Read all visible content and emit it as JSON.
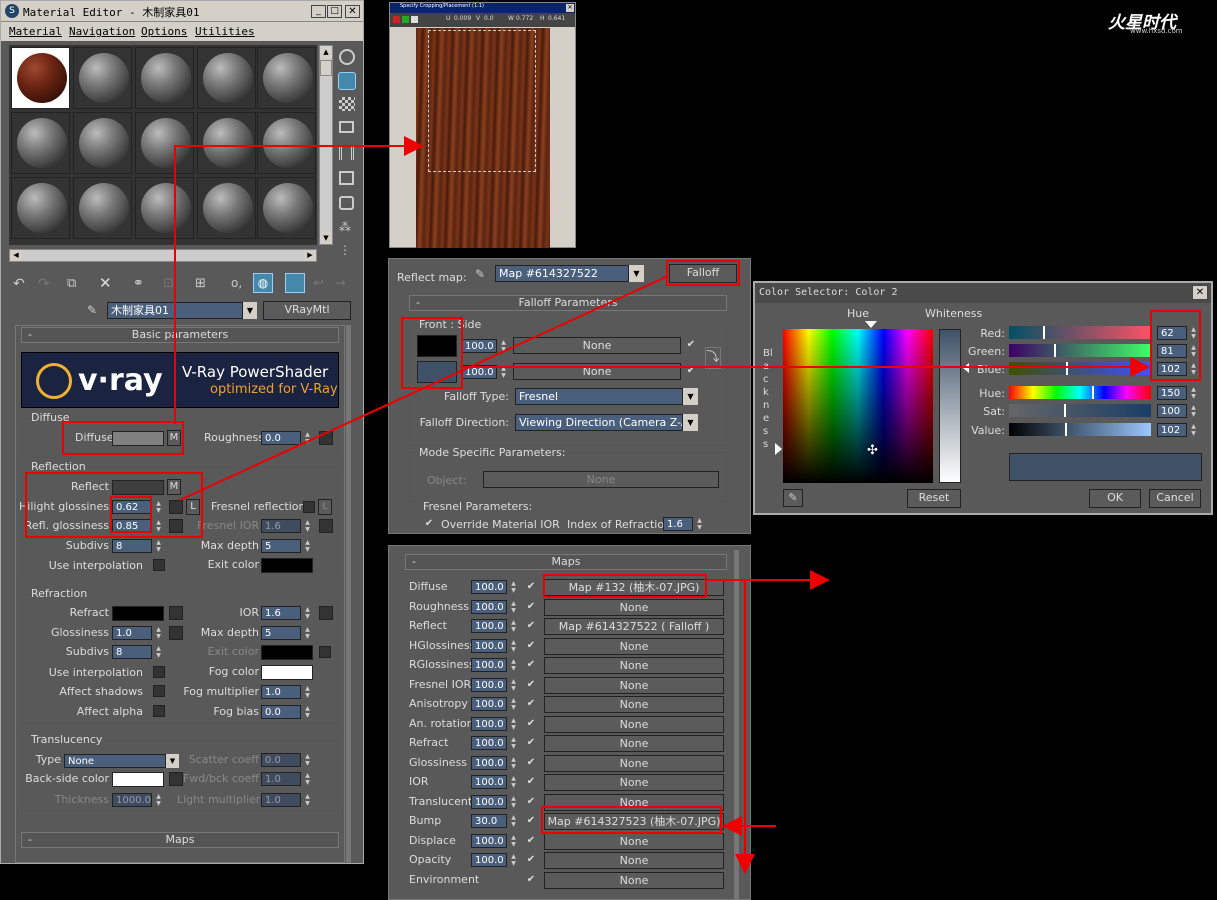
{
  "logo_text": "火星时代",
  "logo_url": "www.hxsd.com",
  "material_editor": {
    "title": "Material Editor - 木制家具01",
    "menu": [
      "Material",
      "Navigation",
      "Options",
      "Utilities"
    ],
    "material_name": "木制家具01",
    "material_type": "VRayMtl",
    "vray_banner": {
      "brand": "v·ray",
      "line1": "V-Ray PowerShader",
      "line2": "optimized for V-Ray"
    },
    "basic_parameters": "Basic parameters",
    "diffuse": {
      "group": "Diffuse",
      "label": "Diffuse",
      "map_btn": "M",
      "roughness_label": "Roughness",
      "roughness": "0.0"
    },
    "reflection": {
      "group": "Reflection",
      "reflect_label": "Reflect",
      "map_btn": "M",
      "hilight_label": "Hilight glossiness",
      "hilight": "0.62",
      "lock": "L",
      "fresnel_label": "Fresnel reflections",
      "fresnel_lock": "L",
      "refl_gloss_label": "Refl. glossiness",
      "refl_gloss": "0.85",
      "fresnel_ior_label": "Fresnel IOR",
      "fresnel_ior": "1.6",
      "subdivs_label": "Subdivs",
      "subdivs": "8",
      "max_depth_label": "Max depth",
      "max_depth": "5",
      "use_interp": "Use interpolation",
      "exit_color": "Exit color"
    },
    "refraction": {
      "group": "Refraction",
      "refract_label": "Refract",
      "ior_label": "IOR",
      "ior": "1.6",
      "gloss_label": "Glossiness",
      "gloss": "1.0",
      "max_depth_label": "Max depth",
      "max_depth": "5",
      "subdivs_label": "Subdivs",
      "subdivs": "8",
      "exit_color": "Exit color",
      "use_interp": "Use interpolation",
      "fog_color": "Fog color",
      "affect_shadows": "Affect shadows",
      "fog_mult_label": "Fog multiplier",
      "fog_mult": "1.0",
      "affect_alpha": "Affect alpha",
      "fog_bias_label": "Fog bias",
      "fog_bias": "0.0"
    },
    "translucency": {
      "group": "Translucency",
      "type_label": "Type",
      "type": "None",
      "scatter_label": "Scatter coeff",
      "scatter": "0.0",
      "backside_label": "Back-side color",
      "fwdbck_label": "Fwd/bck coeff",
      "fwdbck": "1.0",
      "thickness_label": "Thickness",
      "thickness": "1000.0",
      "light_mult_label": "Light multiplier",
      "light_mult": "1.0"
    },
    "maps_rollout": "Maps"
  },
  "crop_window": {
    "title": "Specify Cropping/Placement (1:1)",
    "u_label": "U",
    "u": "0.009",
    "v_label": "V",
    "v": "0.0",
    "w_label": "W",
    "w": "0.772",
    "h_label": "H",
    "h": "0.641"
  },
  "falloff_panel": {
    "reflect_map_label": "Reflect map:",
    "map_name": "Map #614327522",
    "map_type": "Falloff",
    "rollout": "Falloff Parameters",
    "front_side": "Front : Side",
    "slot1_amount": "100.0",
    "slot1_map": "None",
    "slot2_amount": "100.0",
    "slot2_map": "None",
    "falloff_type_label": "Falloff Type:",
    "falloff_type": "Fresnel",
    "falloff_dir_label": "Falloff Direction:",
    "falloff_dir": "Viewing Direction (Camera Z-Axis)",
    "mode_specific": "Mode Specific Parameters:",
    "object_label": "Object:",
    "object_value": "None",
    "fresnel_params": "Fresnel Parameters:",
    "override_ior": "Override Material IOR",
    "ior_label": "Index of Refraction",
    "ior": "1.6"
  },
  "color_selector": {
    "title": "Color Selector: Color 2",
    "hue_label": "Hue",
    "whiteness_label": "Whiteness",
    "blackness_label": "Blackness",
    "red_label": "Red:",
    "red": "62",
    "green_label": "Green:",
    "green": "81",
    "blue_label": "Blue:",
    "blue": "102",
    "hue2_label": "Hue:",
    "hue": "150",
    "sat_label": "Sat:",
    "sat": "100",
    "value_label": "Value:",
    "value": "102",
    "reset": "Reset",
    "ok": "OK",
    "cancel": "Cancel",
    "swatch_color": "#3e5166"
  },
  "maps_panel": {
    "title": "Maps",
    "rows": [
      {
        "name": "Diffuse",
        "amount": "100.0",
        "map": "Map #132 (柚木-07.JPG)"
      },
      {
        "name": "Roughness",
        "amount": "100.0",
        "map": "None"
      },
      {
        "name": "Reflect",
        "amount": "100.0",
        "map": "Map #614327522  ( Falloff )"
      },
      {
        "name": "HGlossiness",
        "amount": "100.0",
        "map": "None"
      },
      {
        "name": "RGlossiness",
        "amount": "100.0",
        "map": "None"
      },
      {
        "name": "Fresnel IOR",
        "amount": "100.0",
        "map": "None"
      },
      {
        "name": "Anisotropy",
        "amount": "100.0",
        "map": "None"
      },
      {
        "name": "An. rotation",
        "amount": "100.0",
        "map": "None"
      },
      {
        "name": "Refract",
        "amount": "100.0",
        "map": "None"
      },
      {
        "name": "Glossiness",
        "amount": "100.0",
        "map": "None"
      },
      {
        "name": "IOR",
        "amount": "100.0",
        "map": "None"
      },
      {
        "name": "Translucent",
        "amount": "100.0",
        "map": "None"
      },
      {
        "name": "Bump",
        "amount": "30.0",
        "map": "Map #614327523 (柚木-07.JPG)"
      },
      {
        "name": "Displace",
        "amount": "100.0",
        "map": "None"
      },
      {
        "name": "Opacity",
        "amount": "100.0",
        "map": "None"
      },
      {
        "name": "Environment",
        "amount": "",
        "map": "None"
      }
    ]
  }
}
